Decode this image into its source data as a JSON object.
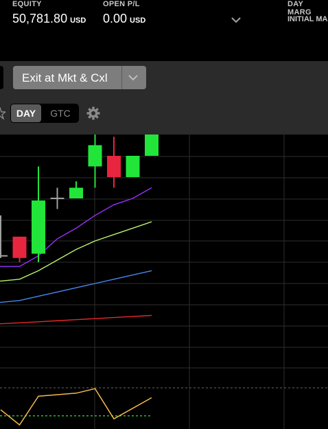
{
  "header": {
    "equity_label": "EQUITY",
    "equity_value": "50,781.80",
    "equity_currency": "USD",
    "open_pl_label": "OPEN P/L",
    "open_pl_value": "0.00",
    "open_pl_currency": "USD",
    "day_margin_label": "DAY MARG",
    "initial_margin_label": "INITIAL MA"
  },
  "toolbar": {
    "exit_button_label": "Exit at Mkt & Cxl",
    "tif_day": "DAY",
    "tif_gtc": "GTC",
    "tif_selected": "DAY"
  },
  "icons": {
    "expand": "chevron-down-icon",
    "exit_dropdown": "chevron-down-icon",
    "settings": "gear-icon",
    "favorite": "star-icon"
  },
  "chart_data": {
    "type": "candlestick",
    "colors": {
      "up": "#22e53a",
      "down": "#e8253f",
      "neutral": "#a0a0a0",
      "grid": "#2e2e2e"
    },
    "candles": [
      {
        "o": 14.3,
        "h": 16.2,
        "l": 14.2,
        "c": 14.35,
        "dir": "neutral"
      },
      {
        "o": 15.2,
        "h": 15.2,
        "l": 14.0,
        "c": 14.2,
        "dir": "down"
      },
      {
        "o": 14.4,
        "h": 18.5,
        "l": 14.0,
        "c": 16.9,
        "dir": "up"
      },
      {
        "o": 17.0,
        "h": 17.5,
        "l": 16.5,
        "c": 17.0,
        "dir": "neutral"
      },
      {
        "o": 17.0,
        "h": 17.8,
        "l": 17.0,
        "c": 17.5,
        "dir": "up"
      },
      {
        "o": 18.5,
        "h": 20.4,
        "l": 17.5,
        "c": 19.5,
        "dir": "up"
      },
      {
        "o": 19.0,
        "h": 19.9,
        "l": 17.5,
        "c": 18.0,
        "dir": "down"
      },
      {
        "o": 18.0,
        "h": 19.0,
        "l": 18.0,
        "c": 19.0,
        "dir": "up"
      },
      {
        "o": 19.0,
        "h": 20.0,
        "l": 19.0,
        "c": 20.0,
        "dir": "up"
      }
    ],
    "moving_averages": [
      {
        "color": "#9b30ff",
        "values": [
          13.8,
          13.8,
          14.3,
          15.1,
          15.6,
          16.2,
          16.7,
          17.0,
          17.5
        ]
      },
      {
        "color": "#b9f46a",
        "values": [
          13.1,
          13.2,
          13.6,
          14.1,
          14.6,
          15.0,
          15.3,
          15.6,
          15.9
        ]
      },
      {
        "color": "#4a87f2",
        "values": [
          12.1,
          12.2,
          12.4,
          12.6,
          12.8,
          13.0,
          13.2,
          13.4,
          13.6
        ]
      },
      {
        "color": "#e82828",
        "values": [
          11.1,
          11.15,
          11.2,
          11.25,
          11.3,
          11.35,
          11.4,
          11.45,
          11.5
        ]
      }
    ],
    "indicator": {
      "color": "#f5b94a",
      "reference_color": "#2ecc40",
      "values": [
        0.5,
        0.0,
        0.95,
        1.0,
        1.05,
        1.2,
        0.2,
        0.55,
        0.9
      ],
      "reference": 0.3
    }
  }
}
